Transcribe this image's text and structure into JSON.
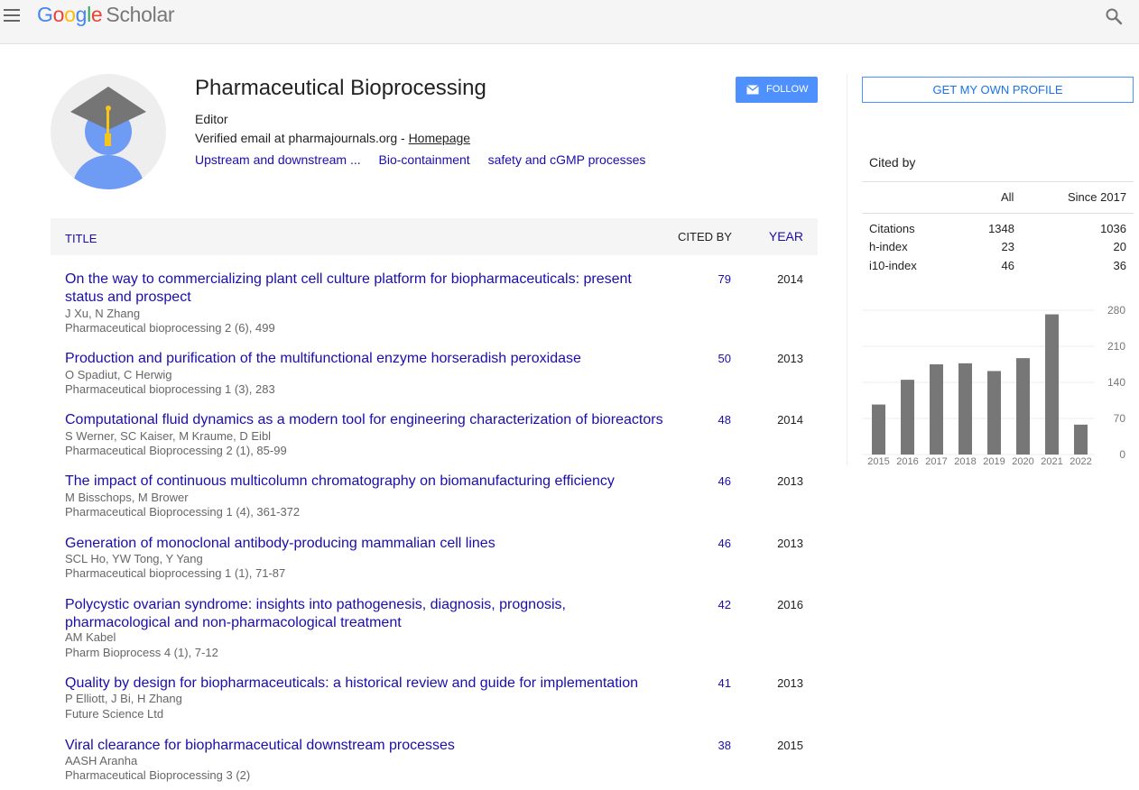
{
  "header": {
    "logo": {
      "g1": "G",
      "o1": "o",
      "o2": "o",
      "g2": "g",
      "l": "l",
      "e": "e",
      "scholar": "Scholar"
    },
    "icons": {
      "menu": "hamburger-menu-icon",
      "search": "search-icon"
    }
  },
  "profile": {
    "name": "Pharmaceutical Bioprocessing",
    "affiliation": "Editor",
    "email_text": "Verified email at pharmajournals.org - ",
    "homepage_label": "Homepage",
    "interests": [
      "Upstream and downstream ...",
      "Bio-containment",
      "safety and cGMP processes"
    ],
    "follow_label": "FOLLOW"
  },
  "table": {
    "headers": {
      "title": "TITLE",
      "cited_by": "CITED BY",
      "year": "YEAR"
    },
    "articles": [
      {
        "title": "On the way to commercializing plant cell culture platform for biopharmaceuticals: present status and prospect",
        "authors": "J Xu, N Zhang",
        "venue": "Pharmaceutical bioprocessing 2 (6), 499",
        "cited_by": "79",
        "year": "2014"
      },
      {
        "title": "Production and purification of the multifunctional enzyme horseradish peroxidase",
        "authors": "O Spadiut, C Herwig",
        "venue": "Pharmaceutical bioprocessing 1 (3), 283",
        "cited_by": "50",
        "year": "2013"
      },
      {
        "title": "Computational fluid dynamics as a modern tool for engineering characterization of bioreactors",
        "authors": "S Werner, SC Kaiser, M Kraume, D Eibl",
        "venue": "Pharmaceutical Bioprocessing 2 (1), 85-99",
        "cited_by": "48",
        "year": "2014"
      },
      {
        "title": "The impact of continuous multicolumn chromatography on biomanufacturing efficiency",
        "authors": "M Bisschops, M Brower",
        "venue": "Pharmaceutical Bioprocessing 1 (4), 361-372",
        "cited_by": "46",
        "year": "2013"
      },
      {
        "title": "Generation of monoclonal antibody-producing mammalian cell lines",
        "authors": "SCL Ho, YW Tong, Y Yang",
        "venue": "Pharmaceutical bioprocessing 1 (1), 71-87",
        "cited_by": "46",
        "year": "2013"
      },
      {
        "title": "Polycystic ovarian syndrome: insights into pathogenesis, diagnosis, prognosis, pharmacological and non-pharmacological treatment",
        "authors": "AM Kabel",
        "venue": "Pharm Bioprocess 4 (1), 7-12",
        "cited_by": "42",
        "year": "2016"
      },
      {
        "title": "Quality by design for biopharmaceuticals: a historical review and guide for implementation",
        "authors": "P Elliott, J Bi, H Zhang",
        "venue": "Future Science Ltd",
        "cited_by": "41",
        "year": "2013"
      },
      {
        "title": "Viral clearance for biopharmaceutical downstream processes",
        "authors": "AASH Aranha",
        "venue": "Pharmaceutical Bioprocessing 3 (2)",
        "cited_by": "38",
        "year": "2015"
      }
    ]
  },
  "sidebar": {
    "get_profile_label": "GET MY OWN PROFILE",
    "cited_by_label": "Cited by",
    "col_all": "All",
    "col_since": "Since 2017",
    "rows": [
      {
        "label": "Citations",
        "all": "1348",
        "since": "1036"
      },
      {
        "label": "h-index",
        "all": "23",
        "since": "20"
      },
      {
        "label": "i10-index",
        "all": "46",
        "since": "36"
      }
    ]
  },
  "chart_data": {
    "type": "bar",
    "title": "",
    "xlabel": "",
    "ylabel": "",
    "categories": [
      "2015",
      "2016",
      "2017",
      "2018",
      "2019",
      "2020",
      "2021",
      "2022"
    ],
    "values": [
      97,
      145,
      175,
      177,
      162,
      187,
      272,
      58
    ],
    "yticks": [
      0,
      70,
      140,
      210,
      280
    ],
    "ylim": [
      0,
      280
    ],
    "grid": true,
    "bar_color": "#777777"
  }
}
